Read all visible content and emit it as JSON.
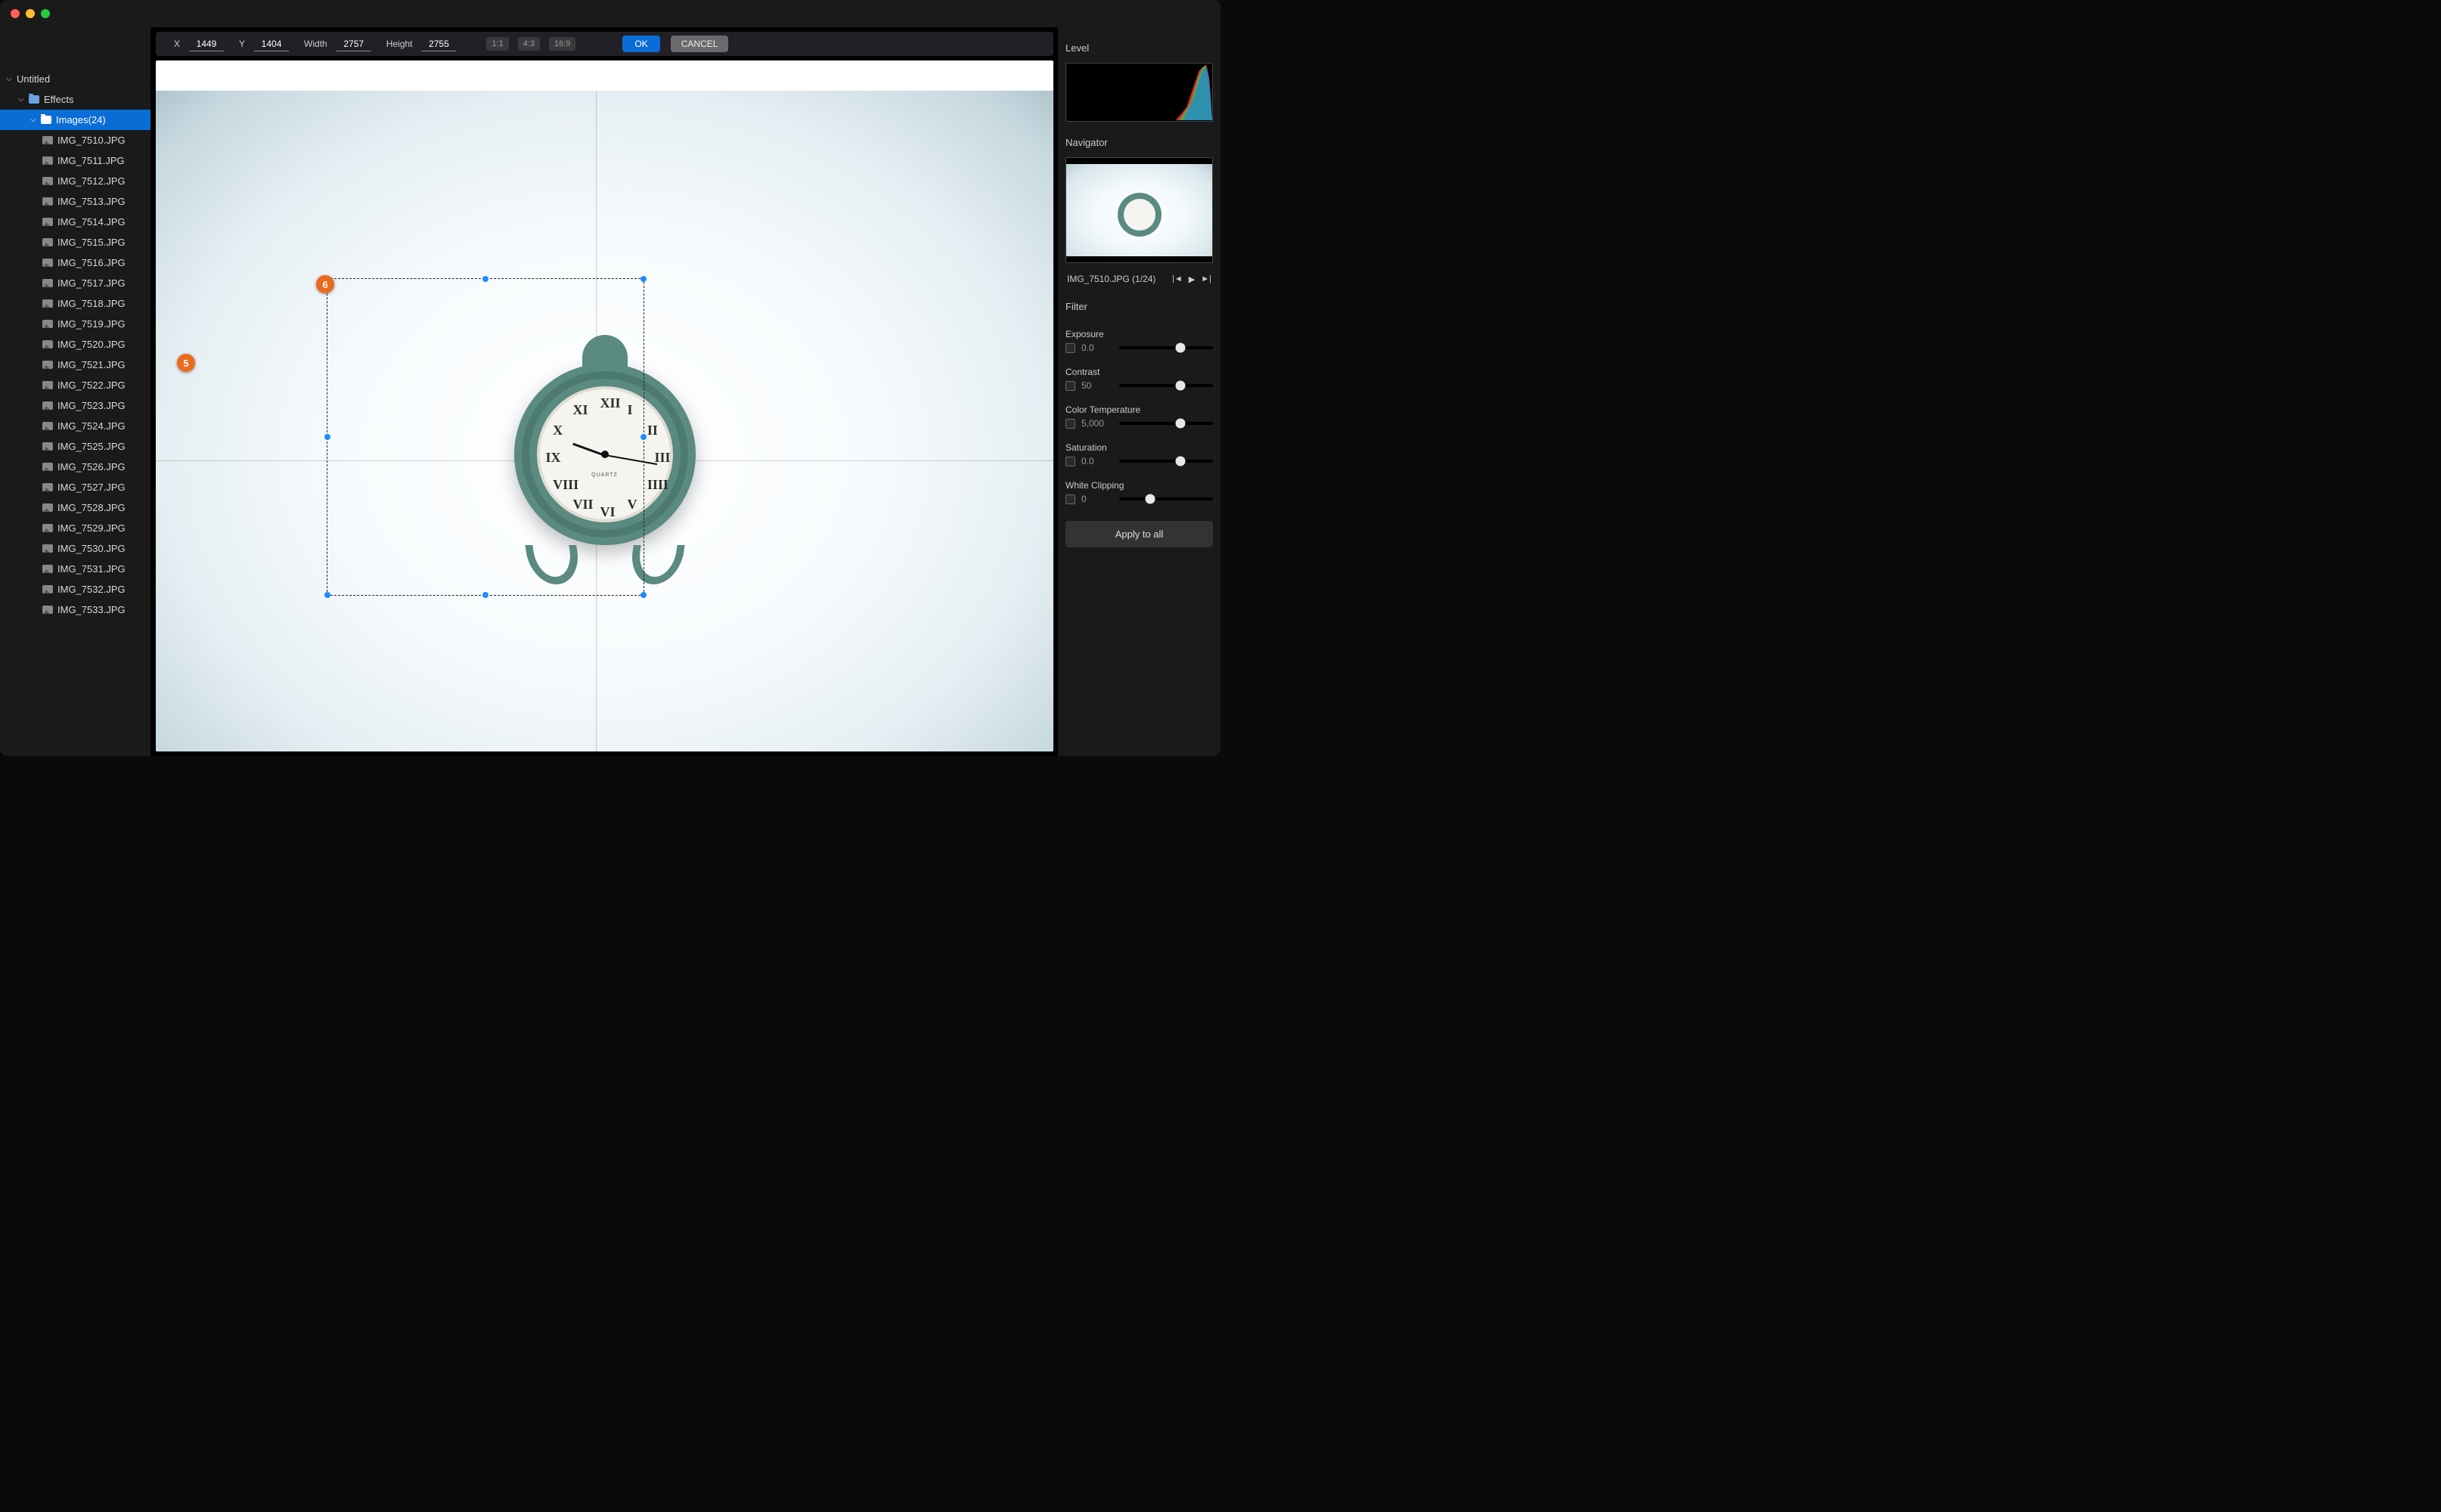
{
  "sidebar": {
    "root": "Untitled",
    "effects": "Effects",
    "images_label": "Images(24)",
    "files": [
      "IMG_7510.JPG",
      "IMG_7511.JPG",
      "IMG_7512.JPG",
      "IMG_7513.JPG",
      "IMG_7514.JPG",
      "IMG_7515.JPG",
      "IMG_7516.JPG",
      "IMG_7517.JPG",
      "IMG_7518.JPG",
      "IMG_7519.JPG",
      "IMG_7520.JPG",
      "IMG_7521.JPG",
      "IMG_7522.JPG",
      "IMG_7523.JPG",
      "IMG_7524.JPG",
      "IMG_7525.JPG",
      "IMG_7526.JPG",
      "IMG_7527.JPG",
      "IMG_7528.JPG",
      "IMG_7529.JPG",
      "IMG_7530.JPG",
      "IMG_7531.JPG",
      "IMG_7532.JPG",
      "IMG_7533.JPG"
    ]
  },
  "toolbar": {
    "x_label": "X",
    "x_value": "1449",
    "y_label": "Y",
    "y_value": "1404",
    "w_label": "Width",
    "w_value": "2757",
    "h_label": "Height",
    "h_value": "2755",
    "ratios": [
      "1:1",
      "4:3",
      "16:9"
    ],
    "ok": "OK",
    "cancel": "CANCEL"
  },
  "annotations": {
    "a5": "5",
    "a6": "6"
  },
  "clock": {
    "brand": "QUARTZ",
    "numerals": [
      "XII",
      "I",
      "II",
      "III",
      "IIII",
      "V",
      "VI",
      "VII",
      "VIII",
      "IX",
      "X",
      "XI"
    ]
  },
  "right": {
    "level": "Level",
    "navigator": "Navigator",
    "nav_status": "IMG_7510.JPG (1/24)",
    "filter": "Filter",
    "exposure": {
      "label": "Exposure",
      "value": "0.0",
      "pos": 65
    },
    "contrast": {
      "label": "Contrast",
      "value": "50",
      "pos": 65
    },
    "colortemp": {
      "label": "Color Temperature",
      "value": "5,000",
      "pos": 65
    },
    "saturation": {
      "label": "Saturation",
      "value": "0.0",
      "pos": 65
    },
    "whiteclip": {
      "label": "White Clipping",
      "value": "0",
      "pos": 33
    },
    "apply": "Apply to all"
  }
}
